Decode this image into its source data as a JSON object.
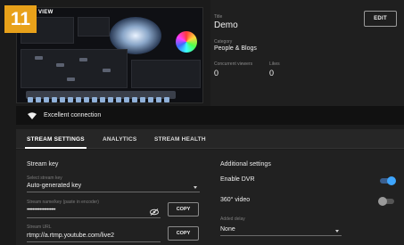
{
  "step_badge": "11",
  "preview": {
    "label": "VIEW"
  },
  "meta": {
    "title_label": "Title",
    "title_value": "Demo",
    "category_label": "Category",
    "category_value": "People & Blogs",
    "viewers_label": "Concurrent viewers",
    "viewers_value": "0",
    "likes_label": "Likes",
    "likes_value": "0",
    "edit_label": "EDIT"
  },
  "connection": {
    "icon": "wifi-icon",
    "status": "Excellent connection"
  },
  "tabs": [
    {
      "label": "STREAM SETTINGS",
      "active": true
    },
    {
      "label": "ANALYTICS",
      "active": false
    },
    {
      "label": "STREAM HEALTH",
      "active": false
    }
  ],
  "stream_key": {
    "section_title": "Stream key",
    "select_label": "Select stream key",
    "select_value": "Auto-generated key",
    "name_label": "Stream name/key (paste in encoder)",
    "name_value": "••••••••••••••••••••",
    "url_label": "Stream URL",
    "url_value": "rtmp://a.rtmp.youtube.com/live2",
    "copy_label": "COPY"
  },
  "additional": {
    "section_title": "Additional settings",
    "dvr_label": "Enable DVR",
    "dvr_enabled": true,
    "video360_label": "360° video",
    "video360_enabled": false,
    "delay_label": "Added delay",
    "delay_value": "None"
  },
  "colors": {
    "badge": "#e8a11a",
    "toggle_on": "#3ea6ff",
    "background": "#1b1b1b"
  }
}
